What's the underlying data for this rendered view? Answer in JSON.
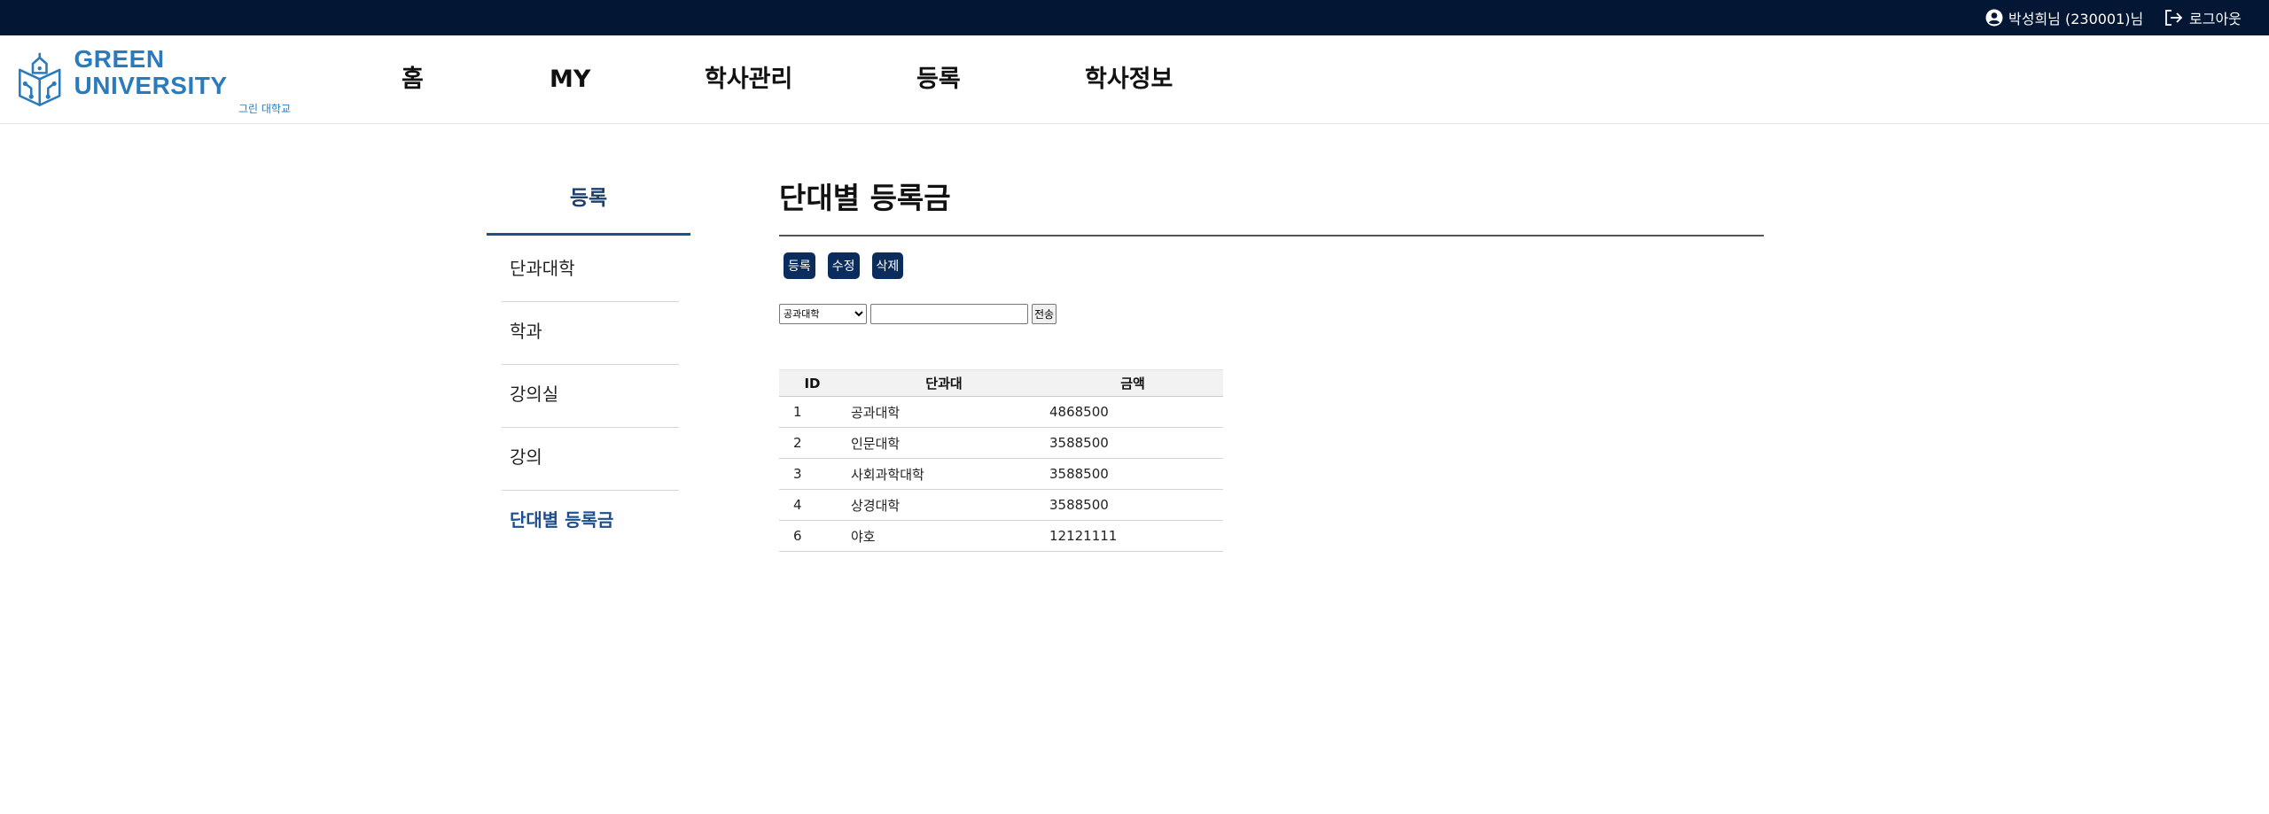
{
  "topbar": {
    "user_label": "박성희님 (230001)님",
    "logout_label": "로그아웃"
  },
  "header": {
    "brand_name": "GREEN UNIVERSITY",
    "brand_sub": "그린 대학교",
    "nav": [
      {
        "label": "홈"
      },
      {
        "label": "MY"
      },
      {
        "label": "학사관리"
      },
      {
        "label": "등록"
      },
      {
        "label": "학사정보"
      }
    ]
  },
  "sidebar": {
    "title": "등록",
    "items": [
      {
        "label": "단과대학"
      },
      {
        "label": "학과"
      },
      {
        "label": "강의실"
      },
      {
        "label": "강의"
      },
      {
        "label": "단대별 등록금",
        "active": true
      }
    ]
  },
  "main": {
    "title": "단대별 등록금",
    "buttons": {
      "create": "등록",
      "edit": "수정",
      "delete": "삭제"
    },
    "search": {
      "selected_option": "공과대학",
      "input_value": "",
      "submit_label": "전송"
    },
    "table": {
      "headers": [
        "ID",
        "단과대",
        "금액"
      ],
      "rows": [
        [
          "1",
          "공과대학",
          "4868500"
        ],
        [
          "2",
          "인문대학",
          "3588500"
        ],
        [
          "3",
          "사회과학대학",
          "3588500"
        ],
        [
          "4",
          "상경대학",
          "3588500"
        ],
        [
          "6",
          "야호",
          "12121111"
        ]
      ]
    }
  },
  "colors": {
    "topbar_bg": "#031633",
    "accent": "#0b2d5e",
    "brand": "#2a7bbd",
    "active_nav": "#1d4f8f"
  }
}
